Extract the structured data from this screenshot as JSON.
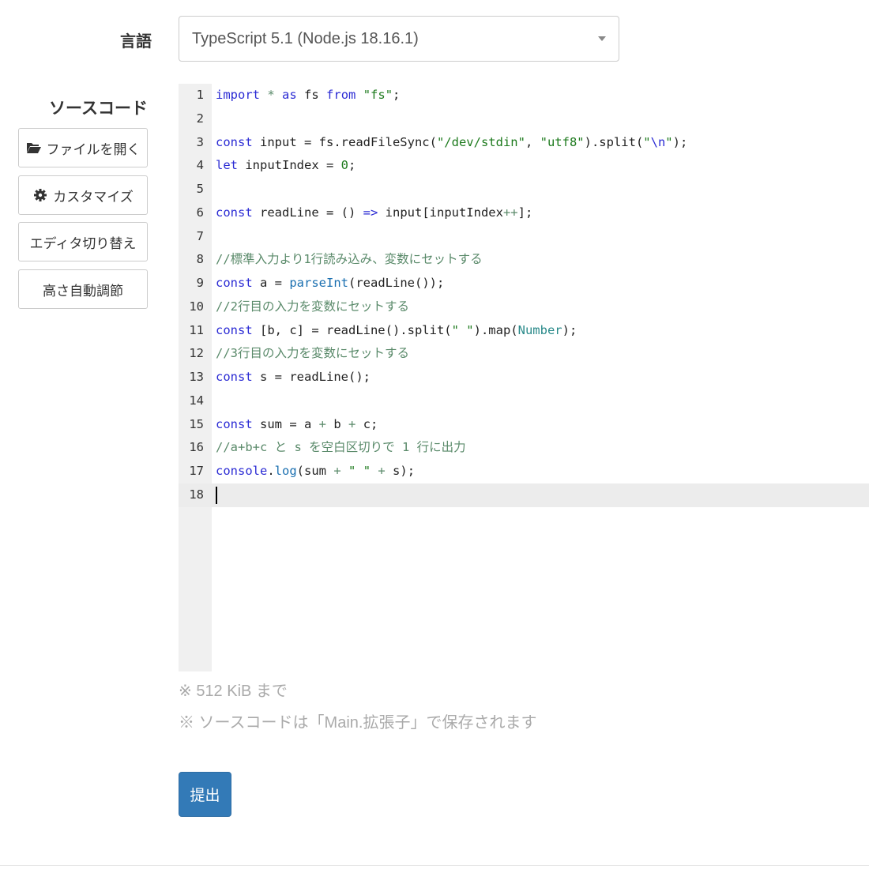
{
  "form": {
    "language_label": "言語",
    "language_selected": "TypeScript 5.1 (Node.js 18.16.1)",
    "source_label": "ソースコード",
    "buttons": {
      "open_file": "ファイルを開く",
      "customize": "カスタマイズ",
      "switch_editor": "エディタ切り替え",
      "auto_height": "高さ自動調節"
    },
    "icons": {
      "open_file": "folder-open-icon",
      "customize": "gear-icon",
      "select": "caret-down-icon"
    },
    "notes": [
      "※ 512 KiB まで",
      "※ ソースコードは「Main.拡張子」で保存されます"
    ],
    "submit_label": "提出"
  },
  "editor": {
    "active_line": 18,
    "lines": [
      [
        [
          "kw",
          "import"
        ],
        [
          "p",
          " "
        ],
        [
          "cm",
          "*"
        ],
        [
          "p",
          " "
        ],
        [
          "kw",
          "as"
        ],
        [
          "p",
          " fs "
        ],
        [
          "kw",
          "from"
        ],
        [
          "p",
          " "
        ],
        [
          "str",
          "\"fs\""
        ],
        [
          "p",
          ";"
        ]
      ],
      [],
      [
        [
          "kw",
          "const"
        ],
        [
          "p",
          " input = fs.readFileSync("
        ],
        [
          "str",
          "\"/dev/stdin\""
        ],
        [
          "p",
          ", "
        ],
        [
          "str",
          "\"utf8\""
        ],
        [
          "p",
          ").split("
        ],
        [
          "str",
          "\""
        ],
        [
          "kw",
          "\\n"
        ],
        [
          "str",
          "\""
        ],
        [
          "p",
          ");"
        ]
      ],
      [
        [
          "kw",
          "let"
        ],
        [
          "p",
          " inputIndex = "
        ],
        [
          "num",
          "0"
        ],
        [
          "p",
          ";"
        ]
      ],
      [],
      [
        [
          "kw",
          "const"
        ],
        [
          "p",
          " readLine = () "
        ],
        [
          "kw",
          "=>"
        ],
        [
          "p",
          " input[inputIndex"
        ],
        [
          "cm",
          "++"
        ],
        [
          "p",
          "];"
        ]
      ],
      [],
      [
        [
          "cm",
          "//標準入力より1行読み込み、変数にセットする"
        ]
      ],
      [
        [
          "kw",
          "const"
        ],
        [
          "p",
          " a = "
        ],
        [
          "fn",
          "parseInt"
        ],
        [
          "p",
          "(readLine());"
        ]
      ],
      [
        [
          "cm",
          "//2行目の入力を変数にセットする"
        ]
      ],
      [
        [
          "kw",
          "const"
        ],
        [
          "p",
          " [b, c] = readLine().split("
        ],
        [
          "str",
          "\" \""
        ],
        [
          "p",
          ").map("
        ],
        [
          "typ",
          "Number"
        ],
        [
          "p",
          ");"
        ]
      ],
      [
        [
          "cm",
          "//3行目の入力を変数にセットする"
        ]
      ],
      [
        [
          "kw",
          "const"
        ],
        [
          "p",
          " s = readLine();"
        ]
      ],
      [],
      [
        [
          "kw",
          "const"
        ],
        [
          "p",
          " sum = a "
        ],
        [
          "cm",
          "+"
        ],
        [
          "p",
          " b "
        ],
        [
          "cm",
          "+"
        ],
        [
          "p",
          " c;"
        ]
      ],
      [
        [
          "cm",
          "//a+b+c と s を空白区切りで 1 行に出力"
        ]
      ],
      [
        [
          "kw",
          "console"
        ],
        [
          "p",
          "."
        ],
        [
          "fn",
          "log"
        ],
        [
          "p",
          "(sum "
        ],
        [
          "cm",
          "+"
        ],
        [
          "p",
          " "
        ],
        [
          "str",
          "\" \""
        ],
        [
          "p",
          " "
        ],
        [
          "cm",
          "+"
        ],
        [
          "p",
          " s);"
        ]
      ],
      []
    ]
  }
}
